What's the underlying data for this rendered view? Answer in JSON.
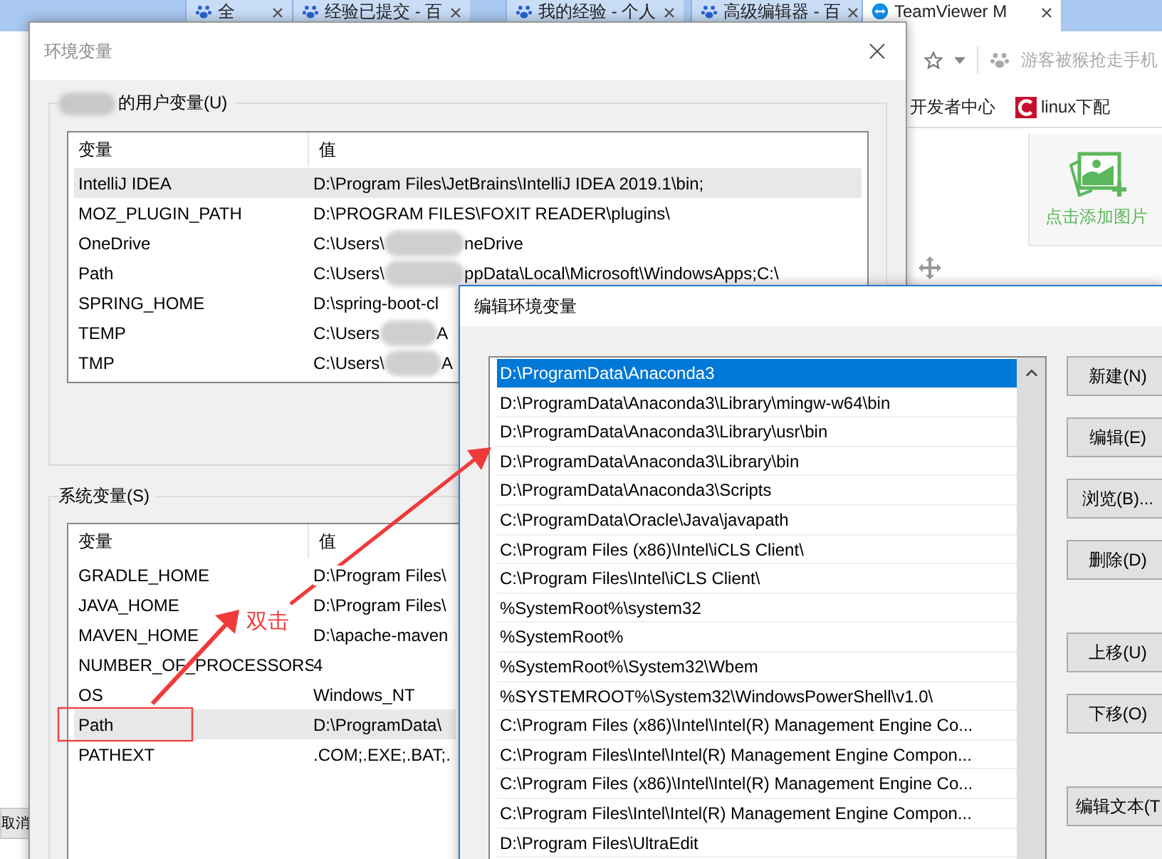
{
  "browser": {
    "tabs": [
      {
        "title": "全",
        "selected": false
      },
      {
        "title": "经验已提交 - 百",
        "selected": false
      },
      {
        "title": "我的经验 - 个人",
        "selected": false
      },
      {
        "title": "高级编辑器 - 百",
        "selected": false
      },
      {
        "title": "TeamViewer M",
        "selected": true
      }
    ],
    "account_text": "游客被猴抢走手机",
    "bookmarks": [
      {
        "label": "开发者中心",
        "kind": "plain"
      },
      {
        "label": "linux下配",
        "kind": "logo"
      }
    ],
    "upload_label": "点击添加图片",
    "side_button": "取消"
  },
  "env_dialog": {
    "title": "环境变量",
    "user_group_label": "的用户变量(U)",
    "user_columns": [
      "变量",
      "值"
    ],
    "user_rows": [
      {
        "name": "IntelliJ IDEA",
        "value": "D:\\Program Files\\JetBrains\\IntelliJ IDEA 2019.1\\bin;",
        "selected": true
      },
      {
        "name": "MOZ_PLUGIN_PATH",
        "value": "D:\\PROGRAM FILES\\FOXIT READER\\plugins\\",
        "selected": false
      },
      {
        "name": "OneDrive",
        "value": "C:\\Users\\",
        "redacted": true,
        "value_tail": "neDrive",
        "selected": false
      },
      {
        "name": "Path",
        "value": "C:\\Users\\",
        "redacted": true,
        "value_tail": "ppData\\Local\\Microsoft\\WindowsApps;C:\\",
        "selected": false
      },
      {
        "name": "SPRING_HOME",
        "value": "D:\\spring-boot-cl",
        "selected": false
      },
      {
        "name": "TEMP",
        "value": "C:\\Users",
        "redacted": true,
        "value_tail": "A",
        "selected": false
      },
      {
        "name": "TMP",
        "value": "C:\\Users\\",
        "redacted": true,
        "value_tail": "A",
        "selected": false
      }
    ],
    "system_group_label": "系统变量(S)",
    "system_columns": [
      "变量",
      "值"
    ],
    "system_rows": [
      {
        "name": "GRADLE_HOME",
        "value": "D:\\Program Files\\",
        "selected": false
      },
      {
        "name": "JAVA_HOME",
        "value": "D:\\Program Files\\",
        "selected": false
      },
      {
        "name": "MAVEN_HOME",
        "value": "D:\\apache-maven",
        "selected": false
      },
      {
        "name": "NUMBER_OF_PROCESSORS",
        "value": "4",
        "selected": false
      },
      {
        "name": "OS",
        "value": "Windows_NT",
        "selected": false
      },
      {
        "name": "Path",
        "value": "D:\\ProgramData\\",
        "selected": true
      },
      {
        "name": "PATHEXT",
        "value": ".COM;.EXE;.BAT;.",
        "selected": false
      }
    ]
  },
  "edit_dialog": {
    "title": "编辑环境变量",
    "entries": [
      {
        "text": "D:\\ProgramData\\Anaconda3",
        "selected": true
      },
      {
        "text": "D:\\ProgramData\\Anaconda3\\Library\\mingw-w64\\bin",
        "selected": false
      },
      {
        "text": "D:\\ProgramData\\Anaconda3\\Library\\usr\\bin",
        "selected": false
      },
      {
        "text": "D:\\ProgramData\\Anaconda3\\Library\\bin",
        "selected": false
      },
      {
        "text": "D:\\ProgramData\\Anaconda3\\Scripts",
        "selected": false
      },
      {
        "text": "C:\\ProgramData\\Oracle\\Java\\javapath",
        "selected": false
      },
      {
        "text": "C:\\Program Files (x86)\\Intel\\iCLS Client\\",
        "selected": false
      },
      {
        "text": "C:\\Program Files\\Intel\\iCLS Client\\",
        "selected": false
      },
      {
        "text": "%SystemRoot%\\system32",
        "selected": false
      },
      {
        "text": "%SystemRoot%",
        "selected": false
      },
      {
        "text": "%SystemRoot%\\System32\\Wbem",
        "selected": false
      },
      {
        "text": "%SYSTEMROOT%\\System32\\WindowsPowerShell\\v1.0\\",
        "selected": false
      },
      {
        "text": "C:\\Program Files (x86)\\Intel\\Intel(R) Management Engine Co...",
        "selected": false
      },
      {
        "text": "C:\\Program Files\\Intel\\Intel(R) Management Engine Compon...",
        "selected": false
      },
      {
        "text": "C:\\Program Files (x86)\\Intel\\Intel(R) Management Engine Co...",
        "selected": false
      },
      {
        "text": "C:\\Program Files\\Intel\\Intel(R) Management Engine Compon...",
        "selected": false
      },
      {
        "text": "D:\\Program Files\\UltraEdit",
        "selected": false
      }
    ],
    "buttons": [
      {
        "label": "新建(N)"
      },
      {
        "label": "编辑(E)"
      },
      {
        "label": "浏览(B)..."
      },
      {
        "label": "删除(D)"
      },
      {
        "label": "上移(U)"
      },
      {
        "label": "下移(O)"
      },
      {
        "label": "编辑文本(T"
      }
    ]
  },
  "annotation": {
    "text": "双击"
  }
}
